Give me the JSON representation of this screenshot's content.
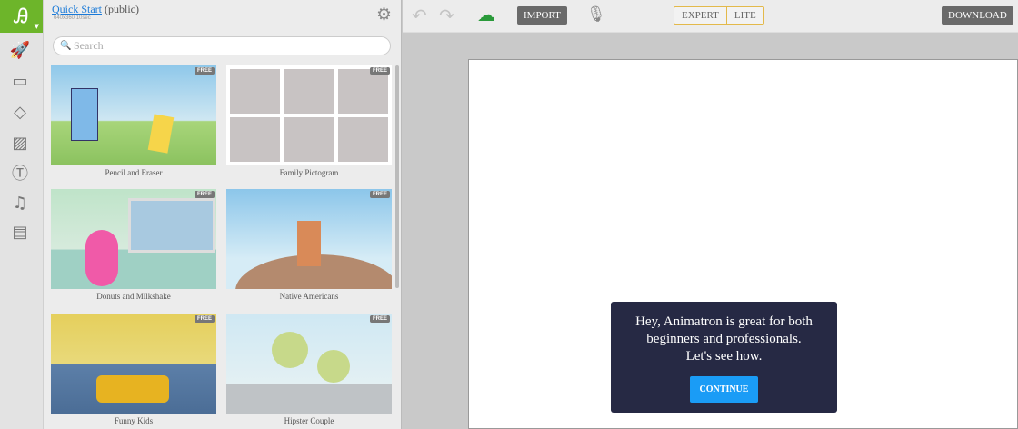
{
  "project": {
    "title": "Quick Start",
    "visibility": "(public)",
    "meta": "640x360 10sec"
  },
  "search": {
    "placeholder": "Search"
  },
  "badge": "FREE",
  "templates": [
    {
      "label": "Pencil and Eraser"
    },
    {
      "label": "Family Pictogram"
    },
    {
      "label": "Donuts and Milkshake"
    },
    {
      "label": "Native Americans"
    },
    {
      "label": "Funny Kids"
    },
    {
      "label": "Hipster Couple"
    }
  ],
  "toolbar": {
    "import": "IMPORT",
    "expert": "EXPERT",
    "lite": "LITE",
    "download": "DOWNLOAD"
  },
  "dialog": {
    "line1": "Hey, Animatron is great for both",
    "line2": "beginners and professionals.",
    "line3": "Let's see how.",
    "button": "CONTINUE"
  },
  "colors": {
    "brand": "#6db52a",
    "dialog": "#262944",
    "accent": "#1a9cf6"
  }
}
